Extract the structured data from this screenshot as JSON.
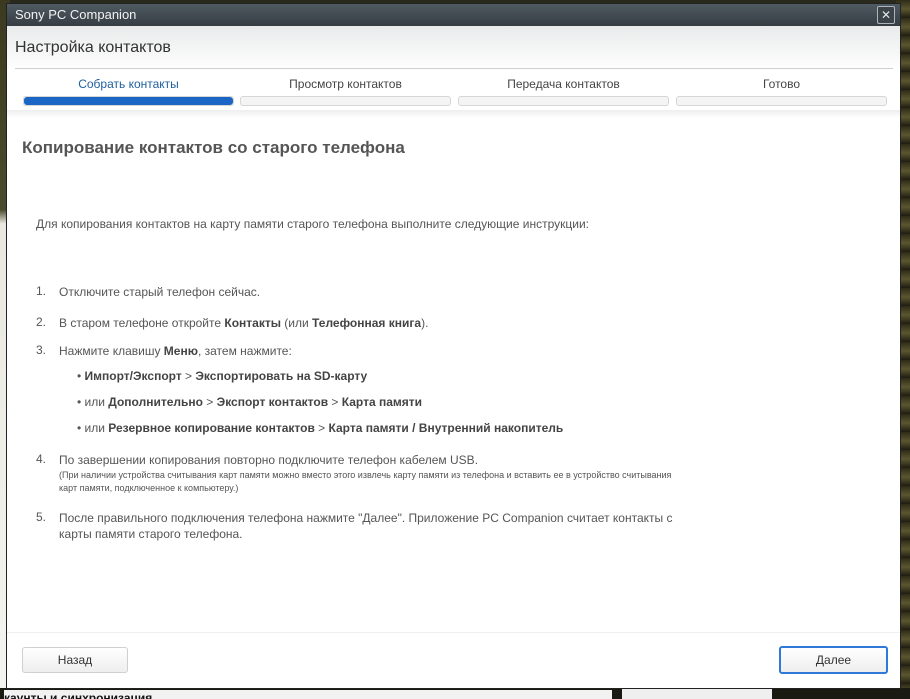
{
  "window": {
    "app_title": "Sony PC Companion",
    "close_glyph": "✕"
  },
  "header": {
    "title": "Настройка контактов"
  },
  "steps": [
    {
      "label": "Собрать контакты",
      "progress": 1.0,
      "active": true
    },
    {
      "label": "Просмотр контактов",
      "progress": 0,
      "active": false
    },
    {
      "label": "Передача контактов",
      "progress": 0,
      "active": false
    },
    {
      "label": "Готово",
      "progress": 0,
      "active": false
    }
  ],
  "main": {
    "heading": "Копирование контактов со старого телефона",
    "intro": "Для копирования контактов на карту памяти старого телефона выполните следующие инструкции:",
    "items": [
      {
        "num": "1.",
        "text": "Отключите старый телефон сейчас."
      },
      {
        "num": "2.",
        "pre": "В старом телефоне откройте ",
        "b1": "Контакты",
        "mid": " (или ",
        "b2": "Телефонная книга",
        "post": ")."
      },
      {
        "num": "3.",
        "pre": "Нажмите клавишу ",
        "b1": "Меню",
        "post": ", затем нажмите:"
      },
      {
        "num": "4.",
        "text": "По завершении копирования повторно подключите телефон кабелем USB.",
        "note": "(При наличии устройства считывания карт памяти можно вместо этого извлечь карту памяти из телефона и вставить ее в устройство считывания карт памяти, подключенное к компьютеру.)"
      },
      {
        "num": "5.",
        "line1": "После правильного подключения телефона нажмите \"Далее\". Приложение PC Companion считает контакты с",
        "line2": "карты памяти старого телефона."
      }
    ],
    "subitems": [
      {
        "bullet": "• ",
        "b1": "Импорт/Экспорт",
        "sep1": " > ",
        "b2": "Экспортировать на SD-карту"
      },
      {
        "bullet": "• или ",
        "b1": "Дополнительно",
        "sep1": " > ",
        "b2": "Экспорт контактов",
        "sep2": " > ",
        "b3": "Карта памяти"
      },
      {
        "bullet": "• или ",
        "b1": "Резервное копирование контактов",
        "sep1": " > ",
        "b2": "Карта памяти / Внутренний накопитель"
      }
    ]
  },
  "footer": {
    "back_label": "Назад",
    "next_label": "Далее"
  },
  "background": {
    "bottom_text": "каунты и синхронизация"
  },
  "colors": {
    "accent": "#1b66c4",
    "active_step_text": "#1f5f9e",
    "titlebar": "#3c444a"
  }
}
